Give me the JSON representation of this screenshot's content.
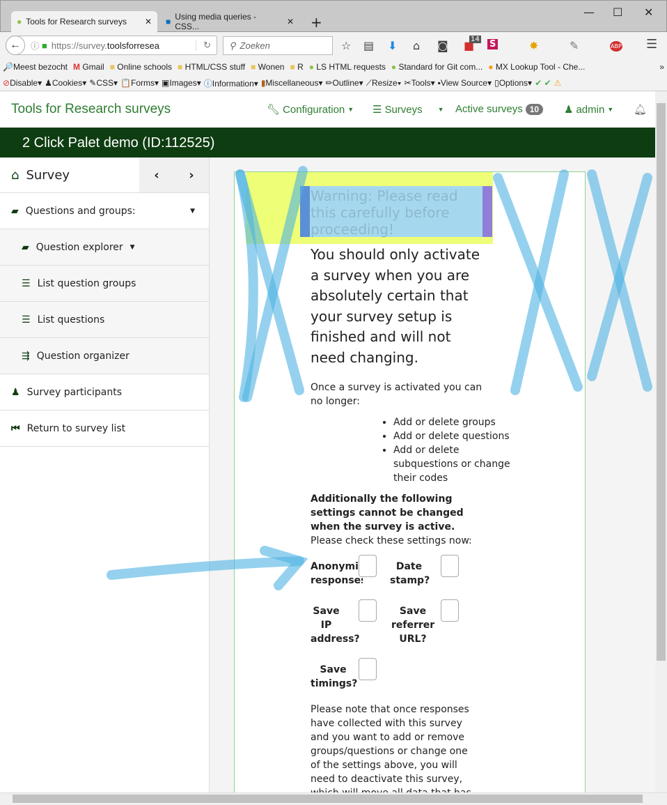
{
  "browser": {
    "tabs": [
      {
        "label": "Tools for Research surveys"
      },
      {
        "label": "Using media queries - CSS..."
      }
    ],
    "new_tab": "+",
    "url": {
      "prefix": "https://survey.",
      "domain": "toolsforresea"
    },
    "search_placeholder": "Zoeken",
    "notification_count": "14",
    "bookmarks": [
      "Meest bezocht",
      "Gmail",
      "Online schools",
      "HTML/CSS stuff",
      "Wonen",
      "R",
      "LS HTML requests",
      "Standard for Git com...",
      "MX Lookup Tool - Che..."
    ],
    "devtools": [
      "Disable▾",
      "Cookies▾",
      "CSS▾",
      "Forms▾",
      "Images▾",
      "Information▾",
      "Miscellaneous▾",
      "Outline▾",
      "Resize▾",
      "Tools▾",
      "View Source▾",
      "Options▾"
    ]
  },
  "navbar": {
    "brand": "Tools for Research surveys",
    "configuration": "Configuration",
    "surveys": "Surveys",
    "active_surveys": "Active surveys",
    "active_count": "10",
    "user": "admin"
  },
  "title": "2 Click Palet demo (ID:112525)",
  "sidebar": {
    "header": "Survey",
    "items": [
      {
        "label": "Questions and groups:"
      },
      {
        "label": "Question explorer"
      },
      {
        "label": "List question groups"
      },
      {
        "label": "List questions"
      },
      {
        "label": "Question organizer"
      },
      {
        "label": "Survey participants"
      },
      {
        "label": "Return to survey list"
      }
    ]
  },
  "main": {
    "warning": "Warning: Please read this carefully before proceeding!",
    "lead": "You should only activate a survey when you are absolutely certain that your survey setup is finished and will not need changing.",
    "once": "Once a survey is activated you can no longer:",
    "list": [
      "Add or delete groups",
      "Add or delete questions",
      "Add or delete subquestions or change their codes"
    ],
    "additionally": "Additionally the following settings cannot be changed when the survey is active.",
    "check": "Please check these settings now:",
    "settings": {
      "anon": "Anonymized responses?",
      "date": "Date stamp?",
      "ip": "Save IP address?",
      "ref": "Save referrer URL?",
      "timings": "Save timings?"
    },
    "note": "Please note that once responses have collected with this survey and you want to add or remove groups/questions or change one of the settings above, you will need to deactivate this survey, which will move all data that has already been"
  }
}
